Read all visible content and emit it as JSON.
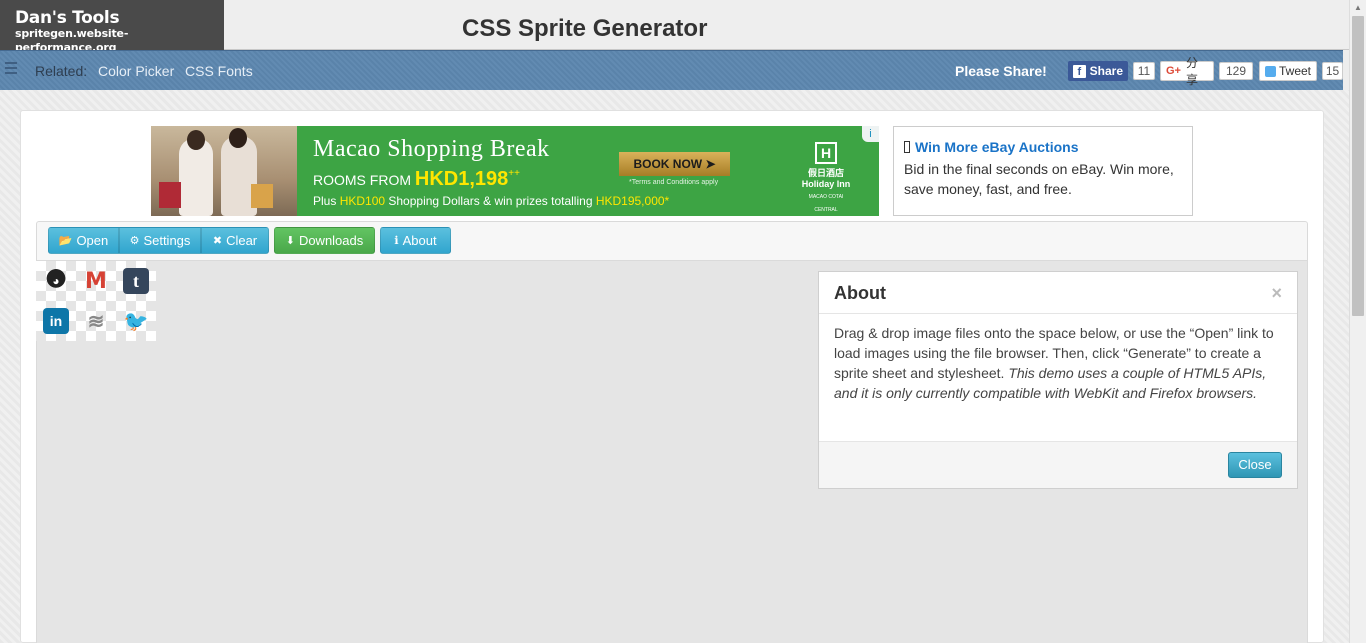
{
  "header": {
    "logo_title": "Dan's Tools",
    "logo_subtitle": "spritegen.website-performance.org",
    "page_title": "CSS Sprite Generator"
  },
  "related_bar": {
    "label": "Related:",
    "links": [
      "Color Picker",
      "CSS Fonts"
    ],
    "share_label": "Please Share!",
    "facebook": {
      "label": "Share",
      "count": "11"
    },
    "googleplus": {
      "icon": "G+",
      "label": "分享",
      "count": "129"
    },
    "twitter": {
      "label": "Tweet",
      "count": "15"
    }
  },
  "ad_banner": {
    "headline": "Macao Shopping Break",
    "rooms_from": "ROOMS FROM ",
    "price": "HKD1,198",
    "price_suffix": "++",
    "offer_prefix": "Plus ",
    "offer_amount": "HKD100",
    "offer_middle": " Shopping Dollars & win prizes totalling ",
    "offer_total": "HKD195,000*",
    "book_now": "BOOK NOW ➤",
    "terms": "*Terms and Conditions apply",
    "hotel_chinese": "假日酒店",
    "hotel_name": "Holiday Inn",
    "hotel_location": "MACAO COTAI CENTRAL",
    "info_glyph": "i"
  },
  "text_ad": {
    "title": "Win More eBay Auctions",
    "body": "Bid in the final seconds on eBay. Win more, save money, fast, and free."
  },
  "toolbar": {
    "open_label": "Open",
    "settings_label": "Settings",
    "clear_label": "Clear",
    "downloads_label": "Downloads",
    "about_label": "About"
  },
  "sprites": [
    {
      "name": "github-icon",
      "glyph": "◕"
    },
    {
      "name": "gmail-icon",
      "glyph": "M"
    },
    {
      "name": "tumblr-icon",
      "glyph": "t"
    },
    {
      "name": "linkedin-icon",
      "glyph": "in"
    },
    {
      "name": "stackoverflow-icon",
      "glyph": "≋"
    },
    {
      "name": "twitter-icon",
      "glyph": "🐦"
    }
  ],
  "about_modal": {
    "title": "About",
    "close_x": "×",
    "body_plain": "Drag & drop image files onto the space below, or use the “Open” link to load images using the file browser. Then, click “Generate” to create a sprite sheet and stylesheet. ",
    "body_italic": "This demo uses a couple of HTML5 APIs, and it is only currently compatible with WebKit and Firefox browsers.",
    "close_label": "Close"
  },
  "colors": {
    "related_bar": "#5d87b0",
    "info_button": "#5bc0de",
    "success_button": "#62c462",
    "facebook": "#3b5998",
    "ad_green": "#3da444"
  }
}
